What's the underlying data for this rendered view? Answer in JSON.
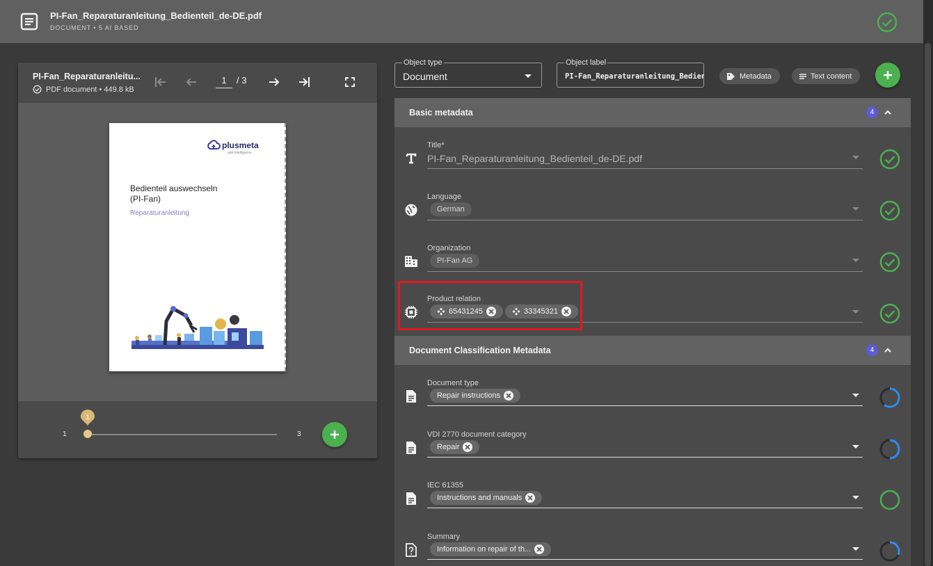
{
  "header": {
    "filename": "PI-Fan_Reparaturanleitung_Bedienteil_de-DE.pdf",
    "subtitle": "DOCUMENT • 5 AI BASED"
  },
  "viewer": {
    "title": "PI-Fan_Reparaturanleitu...",
    "file_info": "PDF document • 449.8 kB",
    "current_page": "1",
    "total_pages": "/ 3",
    "slider_min": "1",
    "slider_max": "3",
    "slider_value": "1",
    "preview": {
      "logo": "plusmeta",
      "logo_tagline": "add intelligence",
      "heading_line1": "Bedienteil auswechseln",
      "heading_line2": "(PI-Fan)",
      "subheading": "Reparaturanleitung"
    }
  },
  "object_type": {
    "label": "Object type",
    "value": "Document"
  },
  "object_label": {
    "label": "Object label",
    "value": "PI-Fan_Reparaturanleitung_Bedienteil_de-DE.pdf"
  },
  "actions": {
    "metadata": "Metadata",
    "text_content": "Text content"
  },
  "sections": {
    "basic": {
      "title": "Basic metadata",
      "count": "4",
      "fields": {
        "title": {
          "label": "Title*",
          "value": "PI-Fan_Reparaturanleitung_Bedienteil_de-DE.pdf"
        },
        "language": {
          "label": "Language",
          "chips": [
            "German"
          ]
        },
        "organization": {
          "label": "Organization",
          "chips": [
            "PI-Fan AG"
          ]
        },
        "product_relation": {
          "label": "Product relation",
          "chips": [
            "65431245",
            "33345321"
          ]
        }
      }
    },
    "classification": {
      "title": "Document Classification Metadata",
      "count": "4",
      "fields": {
        "document_type": {
          "label": "Document type",
          "chips": [
            "Repair instructions"
          ]
        },
        "vdi_category": {
          "label": "VDI 2770 document category",
          "chips": [
            "Repair"
          ]
        },
        "iec": {
          "label": "IEC 61355",
          "chips": [
            "Instructions and manuals"
          ]
        },
        "summary": {
          "label": "Summary",
          "chips": [
            "Information on repair of th..."
          ]
        }
      }
    }
  },
  "colors": {
    "accent_green": "#4caf50",
    "badge_blue": "#5b5bd6",
    "progress_blue": "#2f8cf0",
    "highlight_red": "#e0191f"
  }
}
